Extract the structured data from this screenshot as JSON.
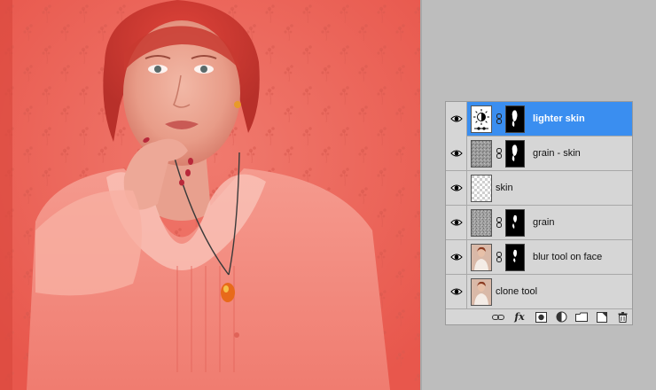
{
  "canvas": {
    "background_color": "#ec6a60"
  },
  "layers_panel": {
    "layers": [
      {
        "name": "lighter skin",
        "selected": true,
        "visible": true,
        "type": "adjustment",
        "has_mask": true
      },
      {
        "name": "grain - skin",
        "selected": false,
        "visible": true,
        "type": "grain",
        "has_mask": true
      },
      {
        "name": "skin",
        "selected": false,
        "visible": true,
        "type": "empty",
        "has_mask": false
      },
      {
        "name": "grain",
        "selected": false,
        "visible": true,
        "type": "grain",
        "has_mask": true
      },
      {
        "name": "blur tool on face",
        "selected": false,
        "visible": true,
        "type": "photo",
        "has_mask": true
      },
      {
        "name": "clone tool",
        "selected": false,
        "visible": true,
        "type": "photo",
        "has_mask": false
      }
    ],
    "footer": {
      "fx_label": "fx",
      "icons": [
        "link-layers-icon",
        "fx-icon",
        "add-mask-icon",
        "adjustment-layer-icon",
        "new-group-icon",
        "new-layer-icon",
        "trash-icon"
      ]
    },
    "colors": {
      "selected": "#3a8ef0",
      "panel": "#d6d6d6"
    }
  }
}
